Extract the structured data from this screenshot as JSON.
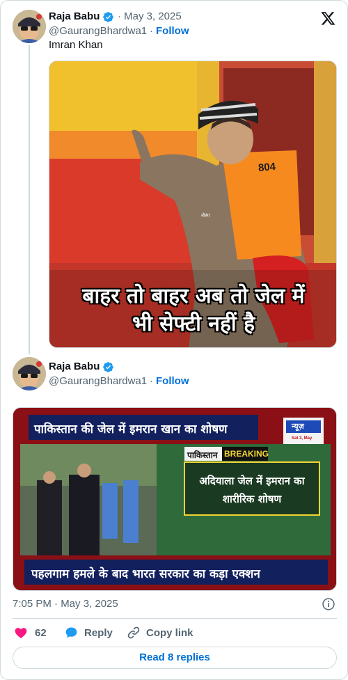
{
  "tweet1": {
    "display_name": "Raja Babu",
    "date": "· May 3, 2025",
    "handle": "@GaurangBhardwa1",
    "separator": "·",
    "follow": "Follow",
    "text": "Imran Khan",
    "meme": {
      "caption_line1": "बाहर तो बाहर अब तो जेल में",
      "caption_line2": "भी सेफ्टी नहीं है",
      "jersey_number": "804",
      "watermark": "नौरंग"
    }
  },
  "tweet2": {
    "display_name": "Raja Babu",
    "handle": "@GaurangBhardwa1",
    "separator": "·",
    "follow": "Follow",
    "news": {
      "top_headline": "पाकिस्तान की जेल में इमरान खान का शोषण",
      "channel": "न्यूज़",
      "channel_date": "Sat 3, May",
      "breaking_tag_country": "पाकिस्तान",
      "breaking_tag": "BREAKING",
      "box_line1": "अदियाला जेल में इमरान का",
      "box_line2": "शारीरिक शोषण",
      "bottom_headline": "पहलगाम हमले के बाद भारत सरकार का कड़ा एक्शन"
    }
  },
  "footer": {
    "timestamp": "7:05 PM · May 3, 2025",
    "likes": "62",
    "reply": "Reply",
    "copy_link": "Copy link",
    "read_replies": "Read 8 replies"
  },
  "colors": {
    "link_blue": "#006fd6",
    "verified_blue": "#1d9bf0",
    "heart_pink": "#f91880",
    "muted": "#536471"
  },
  "icons": [
    "x-logo-icon",
    "verified-badge-icon",
    "info-icon",
    "heart-icon",
    "reply-bubble-icon",
    "link-icon"
  ]
}
